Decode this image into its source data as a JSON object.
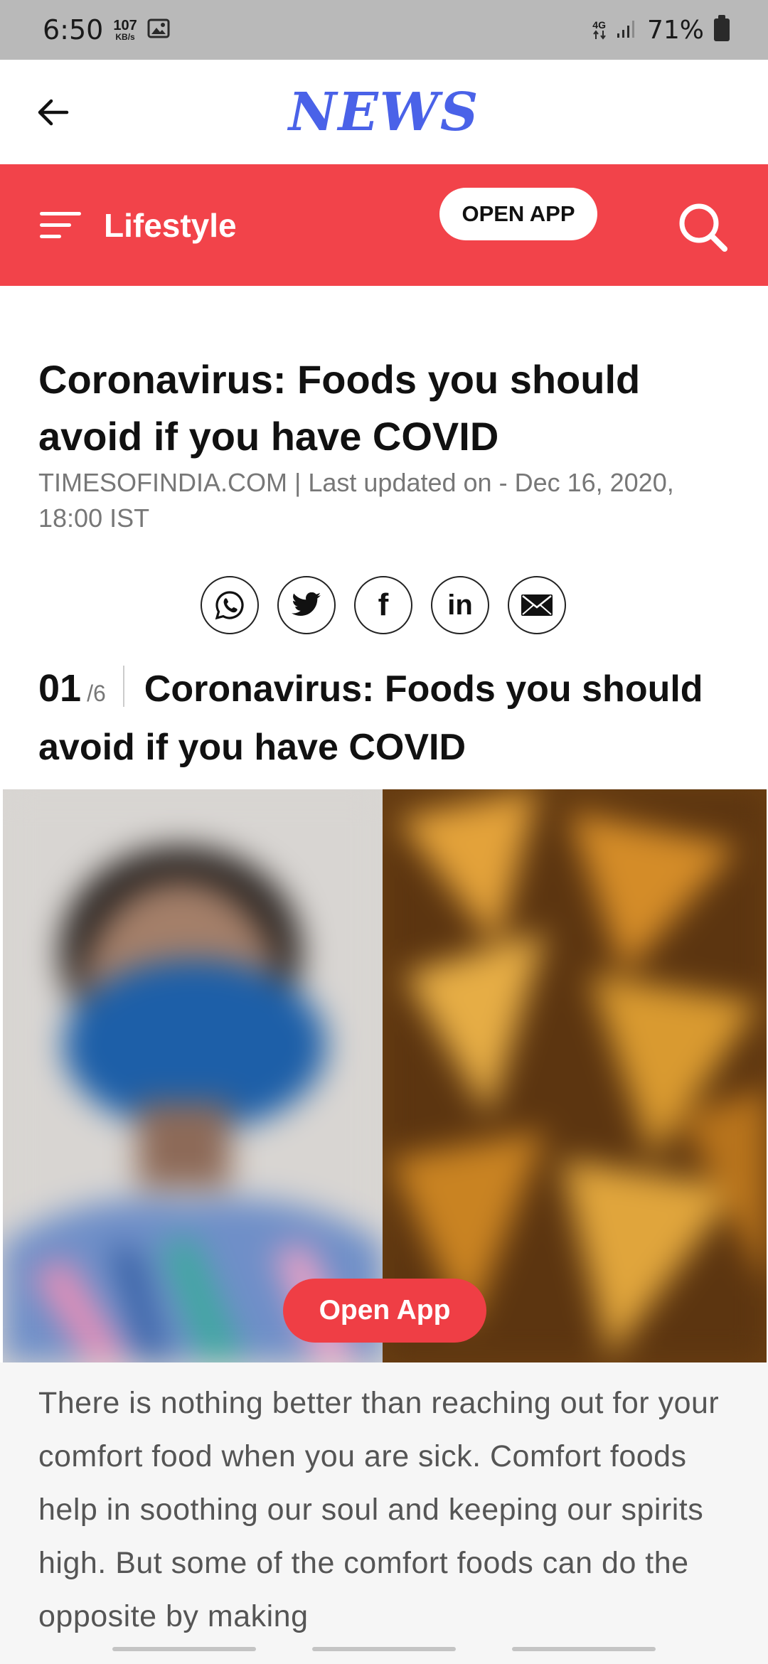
{
  "status_bar": {
    "time": "6:50",
    "net_speed_value": "107",
    "net_speed_unit": "KB/s",
    "network_type": "4G",
    "battery_percent": "71%"
  },
  "header": {
    "logo_text": "NEWS",
    "back_icon": "arrow-left-icon"
  },
  "nav": {
    "section_label": "Lifestyle",
    "open_app_label": "OPEN APP",
    "menu_icon": "hamburger-menu-icon",
    "search_icon": "search-icon"
  },
  "article": {
    "headline": "Coronavirus: Foods you should avoid if you have COVID",
    "meta": "TIMESOFINDIA.COM | Last updated on - Dec 16, 2020, 18:00 IST",
    "share_icons": [
      "whatsapp-icon",
      "twitter-icon",
      "facebook-icon",
      "linkedin-icon",
      "mail-icon"
    ],
    "linkedin_label": "in",
    "facebook_label": "f",
    "slide": {
      "number": "01",
      "total": "/6",
      "title": "Coronavirus: Foods you should avoid if you have COVID"
    },
    "open_app_button": "Open App",
    "body": "There is nothing better than reaching out for your comfort food when you are sick. Comfort foods help in soothing our soul and keeping our spirits high. But some of the comfort foods can do the opposite by making"
  },
  "colors": {
    "brand_red": "#f2434a",
    "logo_blue": "#4a62e8",
    "status_bar_gray": "#b9b9b9"
  }
}
